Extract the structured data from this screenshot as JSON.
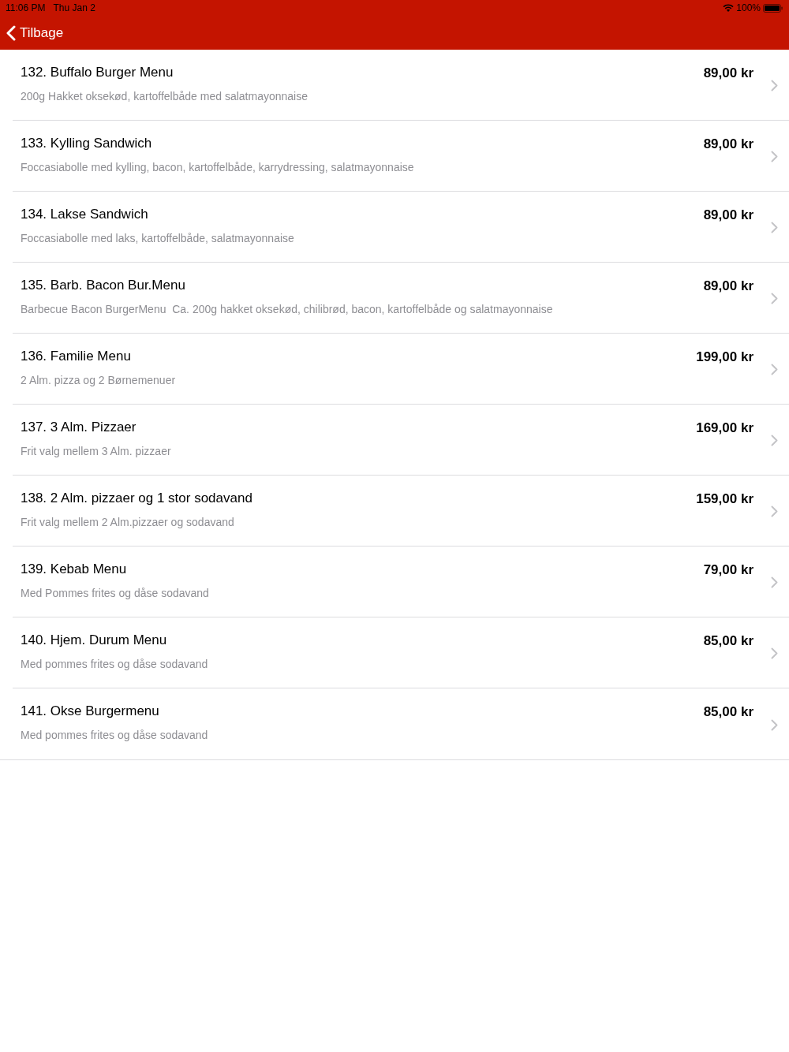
{
  "status_bar": {
    "time": "11:06 PM",
    "date": "Thu Jan 2",
    "battery": "100%"
  },
  "nav_bar": {
    "back_label": "Tilbage"
  },
  "menu_items": [
    {
      "title": "132. Buffalo Burger Menu",
      "description": "200g Hakket oksekød, kartoffelbåde med salatmayonnaise",
      "price": "89,00 kr"
    },
    {
      "title": "133. Kylling Sandwich",
      "description": "Foccasiabolle med kylling, bacon, kartoffelbåde, karrydressing, salatmayonnaise",
      "price": "89,00 kr"
    },
    {
      "title": "134. Lakse Sandwich",
      "description": "Foccasiabolle med laks, kartoffelbåde, salatmayonnaise",
      "price": "89,00 kr"
    },
    {
      "title": "135. Barb. Bacon Bur.Menu",
      "description": "Barbecue Bacon BurgerMenu  Ca. 200g hakket oksekød, chilibrød, bacon, kartoffelbåde og salatmayonnaise",
      "price": "89,00 kr"
    },
    {
      "title": "136. Familie Menu",
      "description": "2 Alm. pizza og 2 Børnemenuer",
      "price": "199,00 kr"
    },
    {
      "title": "137. 3 Alm. Pizzaer",
      "description": "Frit valg mellem 3 Alm. pizzaer",
      "price": "169,00 kr"
    },
    {
      "title": "138. 2 Alm. pizzaer og 1 stor sodavand",
      "description": "Frit valg mellem 2 Alm.pizzaer og sodavand",
      "price": "159,00 kr"
    },
    {
      "title": "139. Kebab Menu",
      "description": "Med Pommes frites og dåse sodavand",
      "price": "79,00 kr"
    },
    {
      "title": "140. Hjem. Durum Menu",
      "description": "Med pommes frites og dåse sodavand",
      "price": "85,00 kr"
    },
    {
      "title": "141. Okse Burgermenu",
      "description": "Med pommes frites og dåse sodavand",
      "price": "85,00 kr"
    }
  ]
}
